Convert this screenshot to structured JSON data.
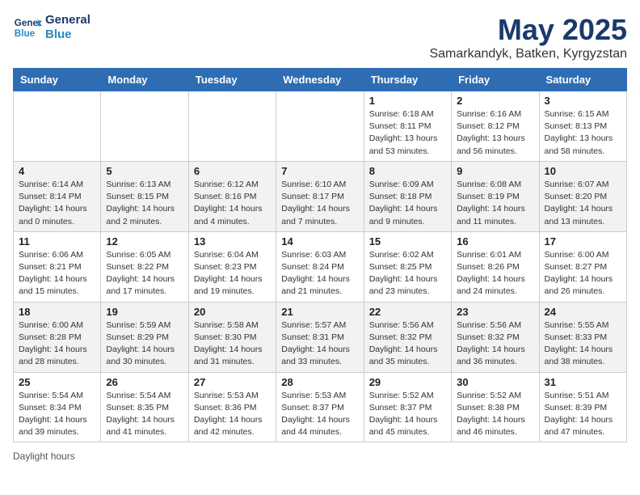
{
  "header": {
    "logo_line1": "General",
    "logo_line2": "Blue",
    "month": "May 2025",
    "location": "Samarkandyk, Batken, Kyrgyzstan"
  },
  "days_of_week": [
    "Sunday",
    "Monday",
    "Tuesday",
    "Wednesday",
    "Thursday",
    "Friday",
    "Saturday"
  ],
  "weeks": [
    [
      {
        "day": "",
        "info": ""
      },
      {
        "day": "",
        "info": ""
      },
      {
        "day": "",
        "info": ""
      },
      {
        "day": "",
        "info": ""
      },
      {
        "day": "1",
        "info": "Sunrise: 6:18 AM\nSunset: 8:11 PM\nDaylight: 13 hours and 53 minutes."
      },
      {
        "day": "2",
        "info": "Sunrise: 6:16 AM\nSunset: 8:12 PM\nDaylight: 13 hours and 56 minutes."
      },
      {
        "day": "3",
        "info": "Sunrise: 6:15 AM\nSunset: 8:13 PM\nDaylight: 13 hours and 58 minutes."
      }
    ],
    [
      {
        "day": "4",
        "info": "Sunrise: 6:14 AM\nSunset: 8:14 PM\nDaylight: 14 hours and 0 minutes."
      },
      {
        "day": "5",
        "info": "Sunrise: 6:13 AM\nSunset: 8:15 PM\nDaylight: 14 hours and 2 minutes."
      },
      {
        "day": "6",
        "info": "Sunrise: 6:12 AM\nSunset: 8:16 PM\nDaylight: 14 hours and 4 minutes."
      },
      {
        "day": "7",
        "info": "Sunrise: 6:10 AM\nSunset: 8:17 PM\nDaylight: 14 hours and 7 minutes."
      },
      {
        "day": "8",
        "info": "Sunrise: 6:09 AM\nSunset: 8:18 PM\nDaylight: 14 hours and 9 minutes."
      },
      {
        "day": "9",
        "info": "Sunrise: 6:08 AM\nSunset: 8:19 PM\nDaylight: 14 hours and 11 minutes."
      },
      {
        "day": "10",
        "info": "Sunrise: 6:07 AM\nSunset: 8:20 PM\nDaylight: 14 hours and 13 minutes."
      }
    ],
    [
      {
        "day": "11",
        "info": "Sunrise: 6:06 AM\nSunset: 8:21 PM\nDaylight: 14 hours and 15 minutes."
      },
      {
        "day": "12",
        "info": "Sunrise: 6:05 AM\nSunset: 8:22 PM\nDaylight: 14 hours and 17 minutes."
      },
      {
        "day": "13",
        "info": "Sunrise: 6:04 AM\nSunset: 8:23 PM\nDaylight: 14 hours and 19 minutes."
      },
      {
        "day": "14",
        "info": "Sunrise: 6:03 AM\nSunset: 8:24 PM\nDaylight: 14 hours and 21 minutes."
      },
      {
        "day": "15",
        "info": "Sunrise: 6:02 AM\nSunset: 8:25 PM\nDaylight: 14 hours and 23 minutes."
      },
      {
        "day": "16",
        "info": "Sunrise: 6:01 AM\nSunset: 8:26 PM\nDaylight: 14 hours and 24 minutes."
      },
      {
        "day": "17",
        "info": "Sunrise: 6:00 AM\nSunset: 8:27 PM\nDaylight: 14 hours and 26 minutes."
      }
    ],
    [
      {
        "day": "18",
        "info": "Sunrise: 6:00 AM\nSunset: 8:28 PM\nDaylight: 14 hours and 28 minutes."
      },
      {
        "day": "19",
        "info": "Sunrise: 5:59 AM\nSunset: 8:29 PM\nDaylight: 14 hours and 30 minutes."
      },
      {
        "day": "20",
        "info": "Sunrise: 5:58 AM\nSunset: 8:30 PM\nDaylight: 14 hours and 31 minutes."
      },
      {
        "day": "21",
        "info": "Sunrise: 5:57 AM\nSunset: 8:31 PM\nDaylight: 14 hours and 33 minutes."
      },
      {
        "day": "22",
        "info": "Sunrise: 5:56 AM\nSunset: 8:32 PM\nDaylight: 14 hours and 35 minutes."
      },
      {
        "day": "23",
        "info": "Sunrise: 5:56 AM\nSunset: 8:32 PM\nDaylight: 14 hours and 36 minutes."
      },
      {
        "day": "24",
        "info": "Sunrise: 5:55 AM\nSunset: 8:33 PM\nDaylight: 14 hours and 38 minutes."
      }
    ],
    [
      {
        "day": "25",
        "info": "Sunrise: 5:54 AM\nSunset: 8:34 PM\nDaylight: 14 hours and 39 minutes."
      },
      {
        "day": "26",
        "info": "Sunrise: 5:54 AM\nSunset: 8:35 PM\nDaylight: 14 hours and 41 minutes."
      },
      {
        "day": "27",
        "info": "Sunrise: 5:53 AM\nSunset: 8:36 PM\nDaylight: 14 hours and 42 minutes."
      },
      {
        "day": "28",
        "info": "Sunrise: 5:53 AM\nSunset: 8:37 PM\nDaylight: 14 hours and 44 minutes."
      },
      {
        "day": "29",
        "info": "Sunrise: 5:52 AM\nSunset: 8:37 PM\nDaylight: 14 hours and 45 minutes."
      },
      {
        "day": "30",
        "info": "Sunrise: 5:52 AM\nSunset: 8:38 PM\nDaylight: 14 hours and 46 minutes."
      },
      {
        "day": "31",
        "info": "Sunrise: 5:51 AM\nSunset: 8:39 PM\nDaylight: 14 hours and 47 minutes."
      }
    ]
  ],
  "footer": "Daylight hours"
}
